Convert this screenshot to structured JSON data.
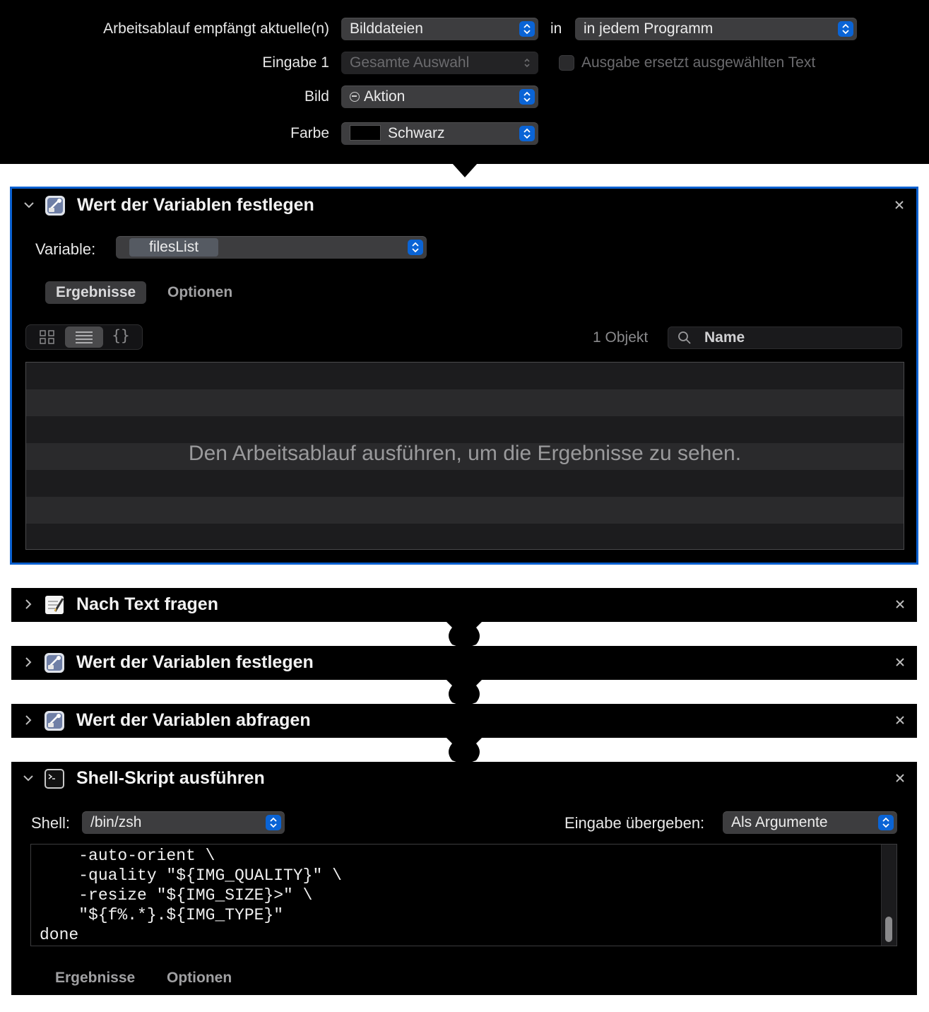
{
  "header": {
    "receives_label": "Arbeitsablauf empfängt aktuelle(n)",
    "receives_value": "Bilddateien",
    "in_label": "in",
    "program_value": "in jedem Programm",
    "input_label": "Eingabe 1",
    "input_value": "Gesamte Auswahl",
    "replace_label": "Ausgabe ersetzt ausgewählten Text",
    "image_label": "Bild",
    "image_value": "Aktion",
    "color_label": "Farbe",
    "color_value": "Schwarz",
    "color_swatch": "#000000"
  },
  "actions": [
    {
      "title": "Wert der Variablen festlegen",
      "expanded": true,
      "variable_label": "Variable:",
      "variable_value": "filesList",
      "tabs": [
        "Ergebnisse",
        "Optionen"
      ],
      "count": "1 Objekt",
      "search_placeholder": "Name",
      "empty_message": "Den Arbeitsablauf ausführen, um die Ergebnisse zu sehen."
    },
    {
      "title": "Nach Text fragen",
      "expanded": false
    },
    {
      "title": "Wert der Variablen festlegen",
      "expanded": false
    },
    {
      "title": "Wert der Variablen abfragen",
      "expanded": false
    },
    {
      "title": "Shell-Skript ausführen",
      "expanded": true,
      "shell_label": "Shell:",
      "shell_value": "/bin/zsh",
      "pass_label": "Eingabe übergeben:",
      "pass_value": "Als Argumente",
      "code": "    -auto-orient \\\n    -quality \"${IMG_QUALITY}\" \\\n    -resize \"${IMG_SIZE}>\" \\\n    \"${f%.*}.${IMG_TYPE}\"\ndone",
      "tabs": [
        "Ergebnisse",
        "Optionen"
      ]
    }
  ],
  "colors": {
    "accent": "#0a64d6",
    "selection_border": "#0a60d0"
  }
}
